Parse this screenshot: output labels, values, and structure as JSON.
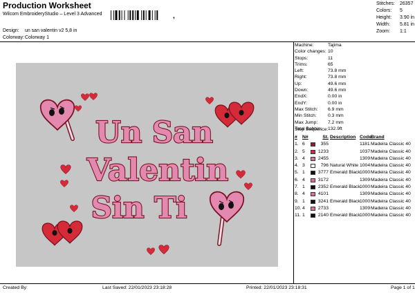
{
  "header": {
    "title": "Production Worksheet",
    "subtitle": "Wilcom EmbroideryStudio – Level 3 Advanced",
    "barcode_mark": ",",
    "design_label": "Design:",
    "design_value": "un san valentin v2 5,8 in",
    "colorway_label": "Colorway:",
    "colorway_value": "Colorway 1"
  },
  "stats": [
    {
      "label": "Stitches:",
      "value": "26357"
    },
    {
      "label": "Colors:",
      "value": "5"
    },
    {
      "label": "Height:",
      "value": "3.90 in"
    },
    {
      "label": "Width:",
      "value": "5.81 in"
    },
    {
      "label": "Zoom:",
      "value": "1:1"
    }
  ],
  "info": [
    {
      "label": "Machine:",
      "value": "Tajima"
    },
    {
      "label": "Color changes:",
      "value": "10"
    },
    {
      "label": "Stops:",
      "value": "11"
    },
    {
      "label": "Trims:",
      "value": "65"
    },
    {
      "label": "Left:",
      "value": "73.8 mm"
    },
    {
      "label": "Right:",
      "value": "73.8 mm"
    },
    {
      "label": "Up:",
      "value": "49.6 mm"
    },
    {
      "label": "Down:",
      "value": "49.6 mm"
    },
    {
      "label": "EndX:",
      "value": "0.00 in"
    },
    {
      "label": "EndY:",
      "value": "0.00 in"
    },
    {
      "label": "Max Stitch:",
      "value": "6.9 mm"
    },
    {
      "label": "Min Stitch:",
      "value": "0.3 mm"
    },
    {
      "label": "Max Jump:",
      "value": "7.2 mm"
    },
    {
      "label": "Total Bobbin:",
      "value": "132.9ft"
    }
  ],
  "sequence": {
    "title": "Stop Sequence:",
    "headers": {
      "n": "#",
      "s": "N#",
      "st": "St.",
      "d": "Description",
      "c": "Code",
      "b": "Brand"
    },
    "rows": [
      {
        "n": "1.",
        "s": "6",
        "color": "#8b2030",
        "st": "355",
        "d": "",
        "c": "1181",
        "b": "Madeira Classic 40"
      },
      {
        "n": "2.",
        "s": "5",
        "color": "#c83040",
        "st": "1233",
        "d": "",
        "c": "1037",
        "b": "Madeira Classic 40"
      },
      {
        "n": "3.",
        "s": "4",
        "color": "#d870a0",
        "st": "2455",
        "d": "",
        "c": "1309",
        "b": "Madeira Classic 40"
      },
      {
        "n": "4.",
        "s": "3",
        "color": "#f6f6f6",
        "st": "796",
        "d": "Natural White",
        "c": "1004",
        "b": "Madeira Classic 40"
      },
      {
        "n": "5.",
        "s": "1",
        "color": "#111111",
        "st": "3777",
        "d": "Emerald Black",
        "c": "1000",
        "b": "Madeira Classic 40"
      },
      {
        "n": "6.",
        "s": "4",
        "color": "#d870a0",
        "st": "3172",
        "d": "",
        "c": "1309",
        "b": "Madeira Classic 40"
      },
      {
        "n": "7.",
        "s": "1",
        "color": "#111111",
        "st": "2352",
        "d": "Emerald Black",
        "c": "1000",
        "b": "Madeira Classic 40"
      },
      {
        "n": "8.",
        "s": "4",
        "color": "#d870a0",
        "st": "4101",
        "d": "",
        "c": "1309",
        "b": "Madeira Classic 40"
      },
      {
        "n": "9.",
        "s": "1",
        "color": "#111111",
        "st": "3241",
        "d": "Emerald Black",
        "c": "1000",
        "b": "Madeira Classic 40"
      },
      {
        "n": "10.",
        "s": "4",
        "color": "#d870a0",
        "st": "2733",
        "d": "",
        "c": "1309",
        "b": "Madeira Classic 40"
      },
      {
        "n": "11.",
        "s": "1",
        "color": "#111111",
        "st": "2140",
        "d": "Emerald Black",
        "c": "1000",
        "b": "Madeira Classic 40"
      }
    ]
  },
  "design_text": {
    "line1": "Un San",
    "line2": "Valentin",
    "line3": "Sin Ti"
  },
  "colors": {
    "pink": "#e389b0",
    "dark_red": "#7a1424",
    "red": "#d52a38",
    "canvas_bg": "#c6c6c6"
  },
  "footer": {
    "created": "Created By:",
    "saved": "Last Saved: 22/01/2023 23:18:28",
    "printed": "Printed: 22/01/2023 23:18:31",
    "page": "Page 1 of 1"
  }
}
